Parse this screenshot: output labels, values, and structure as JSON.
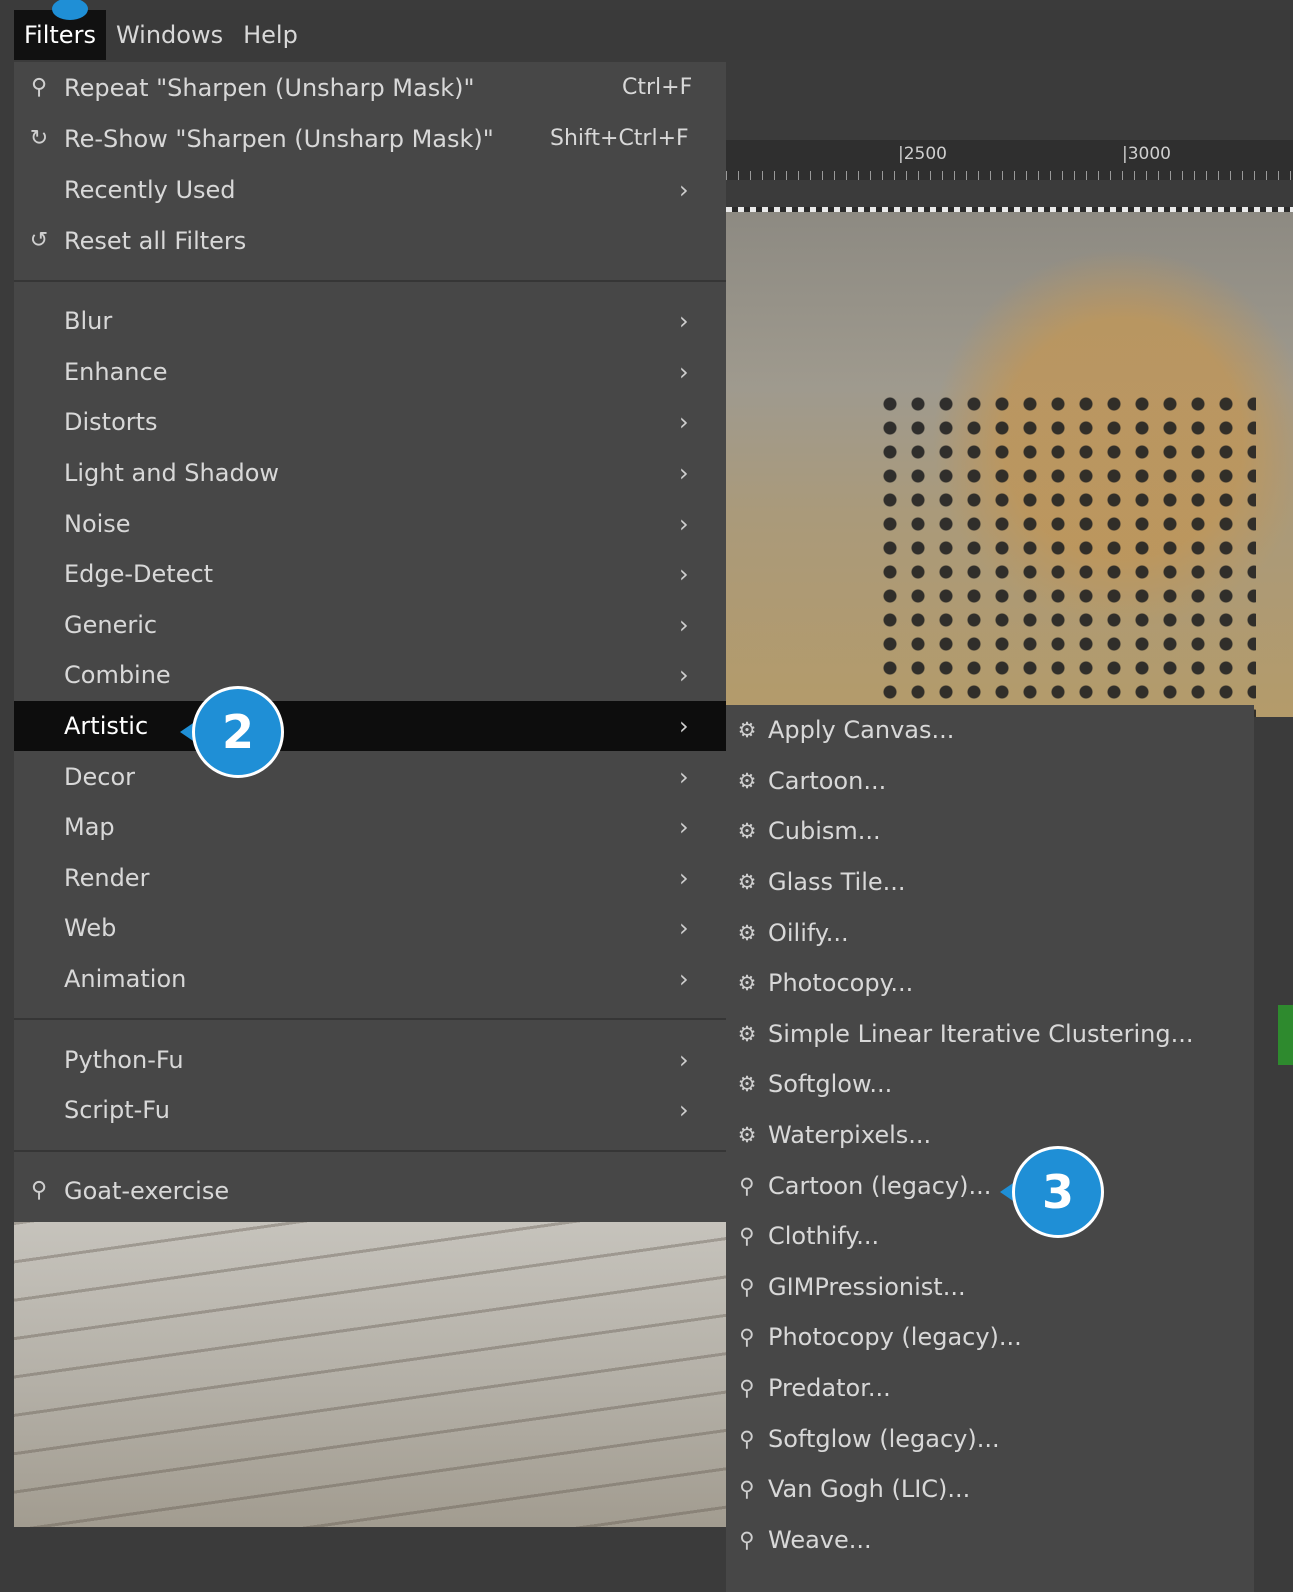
{
  "menubar": {
    "items": [
      {
        "label": "Filters",
        "active": true
      },
      {
        "label": "Windows",
        "active": false
      },
      {
        "label": "Help",
        "active": false
      }
    ]
  },
  "ruler": {
    "labels": [
      "|2500",
      "|3000"
    ]
  },
  "filters_menu": {
    "top": [
      {
        "icon": "plugin-icon",
        "glyph": "⚲",
        "label": "Repeat \"Sharpen (Unsharp Mask)\"",
        "shortcut": "Ctrl+F"
      },
      {
        "icon": "reshow-icon",
        "glyph": "↻",
        "label": "Re-Show \"Sharpen (Unsharp Mask)\"",
        "shortcut": "Shift+Ctrl+F"
      },
      {
        "icon": "",
        "glyph": "",
        "label": "Recently Used",
        "submenu": true
      },
      {
        "icon": "reset-icon",
        "glyph": "↺",
        "label": "Reset all Filters"
      }
    ],
    "categories": [
      {
        "label": "Blur"
      },
      {
        "label": "Enhance"
      },
      {
        "label": "Distorts"
      },
      {
        "label": "Light and Shadow"
      },
      {
        "label": "Noise"
      },
      {
        "label": "Edge-Detect"
      },
      {
        "label": "Generic"
      },
      {
        "label": "Combine"
      },
      {
        "label": "Artistic",
        "selected": true
      },
      {
        "label": "Decor"
      },
      {
        "label": "Map"
      },
      {
        "label": "Render"
      },
      {
        "label": "Web"
      },
      {
        "label": "Animation"
      }
    ],
    "scripts": [
      {
        "label": "Python-Fu"
      },
      {
        "label": "Script-Fu"
      }
    ],
    "bottom": {
      "icon": "plugin-icon",
      "glyph": "⚲",
      "label": "Goat-exercise"
    },
    "arrow": "›"
  },
  "artistic_submenu": {
    "items": [
      {
        "icon": "gegl-icon",
        "glyph": "⚙",
        "label": "Apply Canvas..."
      },
      {
        "icon": "gegl-icon",
        "glyph": "⚙",
        "label": "Cartoon..."
      },
      {
        "icon": "gegl-icon",
        "glyph": "⚙",
        "label": "Cubism..."
      },
      {
        "icon": "gegl-icon",
        "glyph": "⚙",
        "label": "Glass Tile..."
      },
      {
        "icon": "gegl-icon",
        "glyph": "⚙",
        "label": "Oilify..."
      },
      {
        "icon": "gegl-icon",
        "glyph": "⚙",
        "label": "Photocopy..."
      },
      {
        "icon": "gegl-icon",
        "glyph": "⚙",
        "label": "Simple Linear Iterative Clustering..."
      },
      {
        "icon": "gegl-icon",
        "glyph": "⚙",
        "label": "Softglow..."
      },
      {
        "icon": "gegl-icon",
        "glyph": "⚙",
        "label": "Waterpixels..."
      },
      {
        "icon": "plugin-icon",
        "glyph": "⚲",
        "label": "Cartoon (legacy)..."
      },
      {
        "icon": "plugin-icon",
        "glyph": "⚲",
        "label": "Clothify..."
      },
      {
        "icon": "plugin-icon",
        "glyph": "⚲",
        "label": "GIMPressionist..."
      },
      {
        "icon": "plugin-icon",
        "glyph": "⚲",
        "label": "Photocopy (legacy)..."
      },
      {
        "icon": "plugin-icon",
        "glyph": "⚲",
        "label": "Predator..."
      },
      {
        "icon": "plugin-icon",
        "glyph": "⚲",
        "label": "Softglow (legacy)..."
      },
      {
        "icon": "plugin-icon",
        "glyph": "⚲",
        "label": "Van Gogh (LIC)..."
      },
      {
        "icon": "plugin-icon",
        "glyph": "⚲",
        "label": "Weave..."
      }
    ]
  },
  "callouts": {
    "step2": "2",
    "step3": "3"
  },
  "colors": {
    "menu_bg": "#474747",
    "selected_bg": "#0d0d0d",
    "callout": "#1f8fd6"
  }
}
